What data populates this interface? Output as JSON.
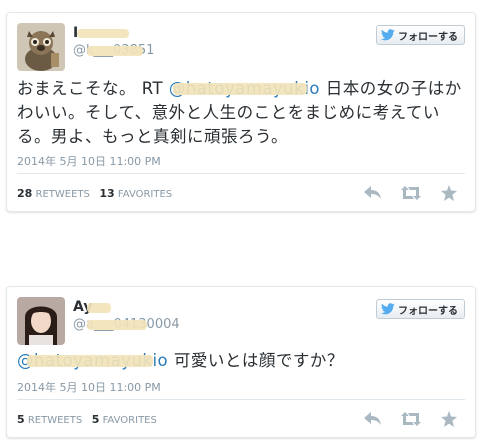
{
  "colors": {
    "accent": "#2b7bb9",
    "muted": "#8899a6",
    "text": "#292f33",
    "redaction": "#f2e3b8"
  },
  "tweets": [
    {
      "name": "I",
      "handle": "@k___03851",
      "avatar_icon": "tanuki-figurine-avatar",
      "follow_label": "フォローする",
      "text_before": "おまえこそな。 RT ",
      "mention": "@hatoyamayukio",
      "text_after_line1": " 日本の女の子はか",
      "text_line2": "わいい。そして、意外と人生のことをまじめに考えてい",
      "text_line3": "る。男よ、もっと真剣に頑張ろう。",
      "timestamp": "2014年 5月 10日  11:00 PM",
      "retweets_count": "28",
      "retweets_label": "RETWEETS",
      "favorites_count": "13",
      "favorites_label": "FAVORITES"
    },
    {
      "name": "Ay",
      "handle": "@a___04130004",
      "avatar_icon": "woman-portrait-avatar",
      "follow_label": "フォローする",
      "mention": "@hatoyamayukio",
      "text_after": " 可愛いとは顔ですか？",
      "timestamp": "2014年 5月 10日  11:00 PM",
      "retweets_count": "5",
      "retweets_label": "RETWEETS",
      "favorites_count": "5",
      "favorites_label": "FAVORITES"
    }
  ]
}
